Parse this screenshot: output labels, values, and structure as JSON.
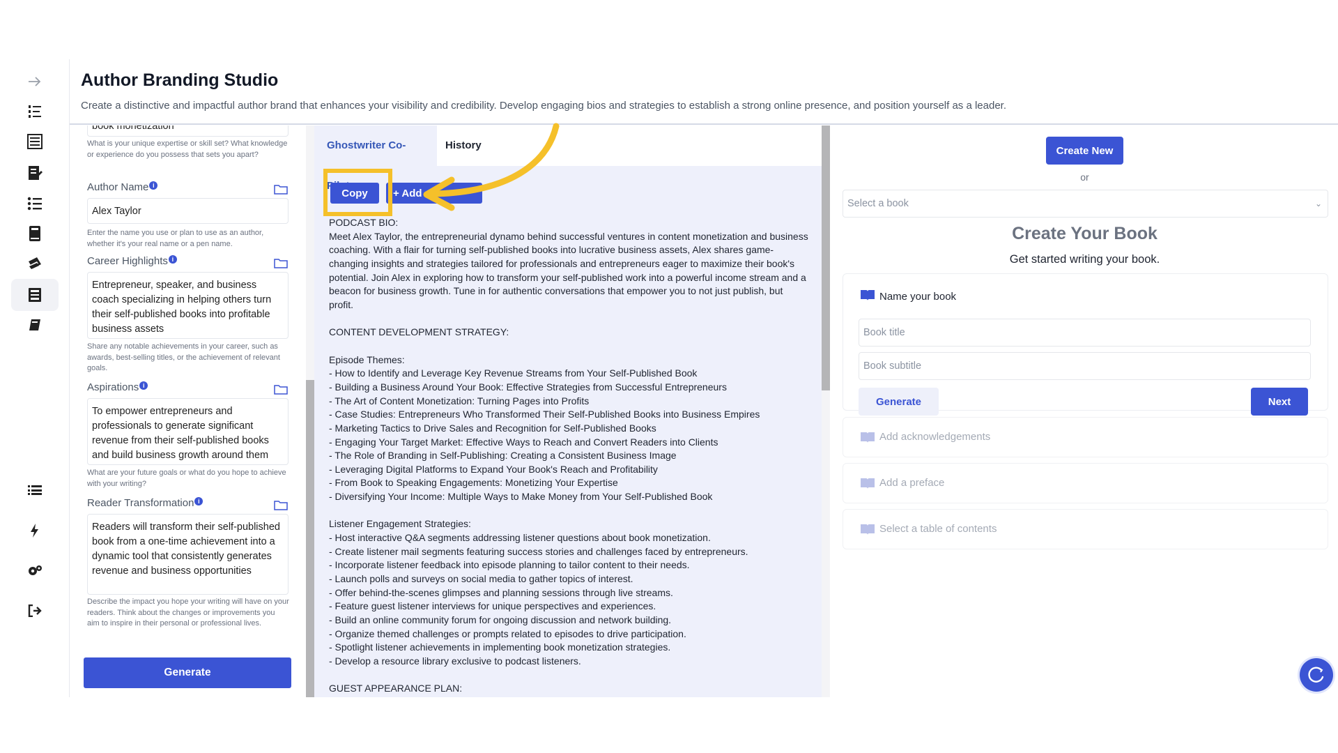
{
  "header": {
    "title": "Author Branding Studio",
    "description": "Create a distinctive and impactful author brand that enhances your visibility and credibility. Develop engaging bios and strategies to establish a strong online presence, and position yourself as a leader."
  },
  "sidebar": {
    "icons": [
      "arrow-right-icon",
      "numbered-list-icon",
      "book-list-icon",
      "notebook-edit-icon",
      "checklist-icon",
      "book-stack-icon",
      "books-icon",
      "branding-studio-icon",
      "book-icon",
      "list-icon",
      "lightning-icon",
      "settings-icon",
      "logout-icon"
    ],
    "active": "branding-studio-icon"
  },
  "form": {
    "top_partial_value": "book monetization",
    "top_help": "What is your unique expertise or skill set? What knowledge or experience do you possess that sets you apart?",
    "author_name": {
      "label": "Author Name",
      "value": "Alex Taylor",
      "help": "Enter the name you use or plan to use as an author, whether it's your real name or a pen name."
    },
    "career_highlights": {
      "label": "Career Highlights",
      "value": "Entrepreneur, speaker, and business coach specializing in helping others turn their self-published books into profitable business assets",
      "help": "Share any notable achievements in your career, such as awards, best-selling titles, or the achievement of relevant goals."
    },
    "aspirations": {
      "label": "Aspirations",
      "value": "To empower entrepreneurs and professionals to generate significant revenue from their self-published books and build business growth around them",
      "help": "What are your future goals or what do you hope to achieve with your writing?"
    },
    "reader_transformation": {
      "label": "Reader Transformation",
      "value": "Readers will transform their self-published book from a one-time achievement into a dynamic tool that consistently generates revenue and business opportunities",
      "help": "Describe the impact you hope your writing will have on your readers. Think about the changes or improvements you aim to inspire in their personal or professional lives."
    },
    "generate_label": "Generate"
  },
  "copilot": {
    "tabs": [
      {
        "label": "Ghostwriter Co-Pilot",
        "active": true
      },
      {
        "label": "History",
        "active": false
      }
    ],
    "copy_label": "Copy",
    "add_label": "+ Add",
    "output": "PODCAST BIO:\nMeet Alex Taylor, the entrepreneurial dynamo behind successful ventures in content monetization and business coaching. With a flair for turning self-published books into lucrative business assets, Alex shares game-changing insights and strategies tailored for professionals and entrepreneurs eager to maximize their book's potential. Join Alex in exploring how to transform your self-published work into a powerful income stream and a beacon for business growth. Tune in for authentic conversations that empower you to not just publish, but profit.\n\nCONTENT DEVELOPMENT STRATEGY:\n\nEpisode Themes:\n- How to Identify and Leverage Key Revenue Streams from Your Self-Published Book\n- Building a Business Around Your Book: Effective Strategies from Successful Entrepreneurs\n- The Art of Content Monetization: Turning Pages into Profits\n- Case Studies: Entrepreneurs Who Transformed Their Self-Published Books into Business Empires\n- Marketing Tactics to Drive Sales and Recognition for Self-Published Books\n- Engaging Your Target Market: Effective Ways to Reach and Convert Readers into Clients\n- The Role of Branding in Self-Publishing: Creating a Consistent Business Image\n- Leveraging Digital Platforms to Expand Your Book's Reach and Profitability\n- From Book to Speaking Engagements: Monetizing Your Expertise\n- Diversifying Your Income: Multiple Ways to Make Money from Your Self-Published Book\n\nListener Engagement Strategies:\n- Host interactive Q&A segments addressing listener questions about book monetization.\n- Create listener mail segments featuring success stories and challenges faced by entrepreneurs.\n- Incorporate listener feedback into episode planning to tailor content to their needs.\n- Launch polls and surveys on social media to gather topics of interest.\n- Offer behind-the-scenes glimpses and planning sessions through live streams.\n- Feature guest listener interviews for unique perspectives and experiences.\n- Build an online community forum for ongoing discussion and network building.\n- Organize themed challenges or prompts related to episodes to drive participation.\n- Spotlight listener achievements in implementing book monetization strategies.\n- Develop a resource library exclusive to podcast listeners.\n\nGUEST APPEARANCE PLAN:"
  },
  "book_panel": {
    "create_new_label": "Create New",
    "or_label": "or",
    "select_placeholder": "Select a book",
    "title": "Create Your Book",
    "subtitle": "Get started writing your book.",
    "name_card": {
      "heading": "Name your book",
      "title_placeholder": "Book title",
      "subtitle_placeholder": "Book subtitle",
      "generate_label": "Generate",
      "next_label": "Next"
    },
    "steps": [
      "Add acknowledgements",
      "Add a preface",
      "Select a table of contents"
    ]
  },
  "colors": {
    "accent": "#3b54d4",
    "highlight": "#f5c02a",
    "panel_bg": "#eef0fb"
  }
}
